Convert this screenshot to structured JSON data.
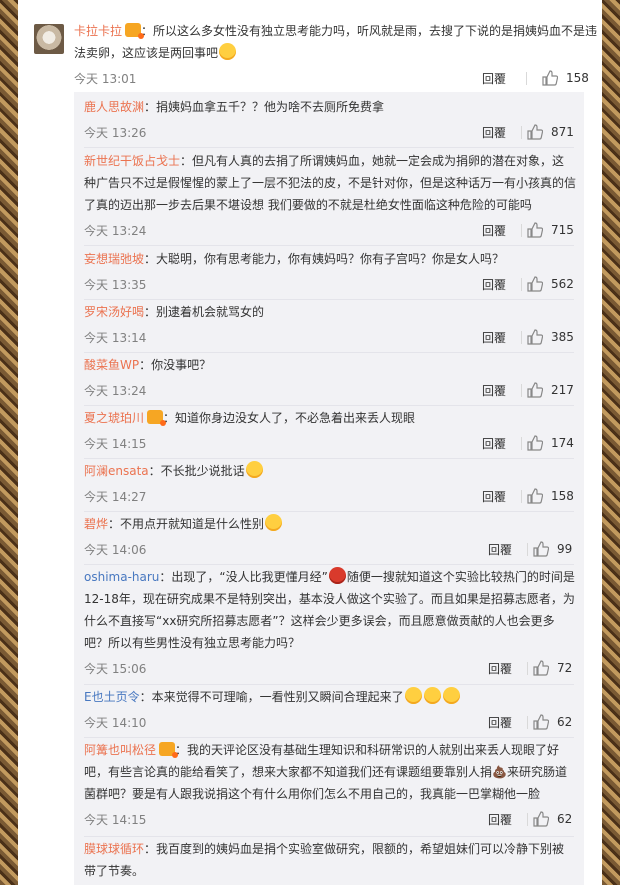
{
  "main": {
    "author": "卡拉卡拉",
    "text": "：所以这么多女性没有独立思考能力吗，听风就是雨，去搜了下说的是捐姨妈血不是违法卖卵，这应该是两回事吧",
    "time": "今天 13:01",
    "reply_label": "回覆",
    "likes": "158"
  },
  "replies": [
    {
      "author": "鹿人思故渊",
      "text": "：捐姨妈血拿五千？？他为啥不去厕所免费拿",
      "time": "今天 13:26",
      "reply_label": "回覆",
      "likes": "871"
    },
    {
      "author": "新世纪干饭占戈士",
      "text": "：但凡有人真的去捐了所谓姨妈血，她就一定会成为捐卵的潜在对象，这种广告只不过是假惺惺的蒙上了一层不犯法的皮，不是针对你，但是这种话万一有小孩真的信了真的迈出那一步去后果不堪设想 我们要做的不就是杜绝女性面临这种危险的可能吗",
      "time": "今天 13:24",
      "reply_label": "回覆",
      "likes": "715"
    },
    {
      "author": "妄想瑞弛坡",
      "text": "：大聪明，你有思考能力，你有姨妈吗？你有子宫吗？你是女人吗？",
      "time": "今天 13:35",
      "reply_label": "回覆",
      "likes": "562"
    },
    {
      "author": "罗宋汤好喝",
      "text": "：别逮着机会就骂女的",
      "time": "今天 13:14",
      "reply_label": "回覆",
      "likes": "385"
    },
    {
      "author": "酸菜鱼WP",
      "text": "：你没事吧？",
      "time": "今天 13:24",
      "reply_label": "回覆",
      "likes": "217"
    },
    {
      "author": "夏之琥珀川",
      "text": "：知道你身边没女人了，不必急着出来丢人现眼",
      "time": "今天 14:15",
      "reply_label": "回覆",
      "likes": "174"
    },
    {
      "author": "阿澜ensata",
      "text": "：不长批少说批话",
      "time": "今天 14:27",
      "reply_label": "回覆",
      "likes": "158"
    },
    {
      "author": "碧烨",
      "text": "：不用点开就知道是什么性别",
      "time": "今天 14:06",
      "reply_label": "回覆",
      "likes": "99"
    },
    {
      "author": "oshima-haru",
      "text": "：出现了，“没人比我更懂月经”",
      "text2": "随便一搜就知道这个实验比较热门的时间是12-18年，现在研究成果不是特别突出，基本没人做这个实验了。而且如果是招募志愿者，为什么不直接写“xx研究所招募志愿者”？这样会少更多误会，而且愿意做贡献的人也会更多吧？所以有些男性没有独立思考能力吗？",
      "time": "今天 15:06",
      "reply_label": "回覆",
      "likes": "72"
    },
    {
      "author": "E也土页令",
      "text": "：本来觉得不可理喻，一看性别又瞬间合理起来了",
      "time": "今天 14:10",
      "reply_label": "回覆",
      "likes": "62"
    },
    {
      "author": "阿篝也叫松径",
      "text": "：我的天评论区没有基础生理知识和科研常识的人就别出来丢人现眼了好吧，有些言论真的能给看笑了，想来大家都不知道我们还有课题组要靠别人捐",
      "text2": "来研究肠道菌群吧？要是有人跟我说捐这个有什么用你们怎么不用自己的，我真能一巴掌糊他一脸",
      "time": "今天 14:15",
      "reply_label": "回覆",
      "likes": "62"
    },
    {
      "author": "膜球球循环",
      "text": "：我百度到的姨妈血是捐个实验室做研究，限额的，希望姐妹们可以冷静下别被带了节奏。",
      "time": "",
      "reply_label": "",
      "likes": ""
    }
  ]
}
